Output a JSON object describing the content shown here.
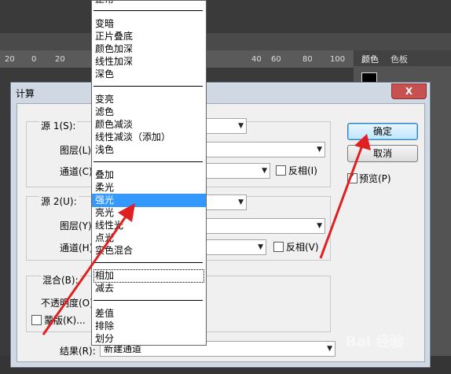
{
  "photoshop": {
    "ruler_ticks": [
      "20",
      "0",
      "20",
      "40",
      "60",
      "80",
      "100"
    ],
    "panel_tabs": [
      "颜色",
      "色板"
    ],
    "watermark": "Bai 经验"
  },
  "dialog": {
    "title": "计算",
    "close": "X",
    "source1": {
      "label": "源 1(S):",
      "layer_label": "图层(L)",
      "channel_label": "通道(C)",
      "invert_label": "反相(I)"
    },
    "source2": {
      "label": "源 2(U):",
      "layer_label": "图层(Y)",
      "channel_label": "通道(H)",
      "invert_label": "反相(V)"
    },
    "blending_label": "混合(B):",
    "blending_value": "相加",
    "opacity_label": "不透明度(O)",
    "mask_label": "蒙版(K)...",
    "result_label": "结果(R):",
    "result_value": "新建通道",
    "ok_label": "确定",
    "cancel_label": "取消",
    "preview_label": "预览(P)"
  },
  "blend_menu": {
    "items": [
      "正常",
      "变暗",
      "正片叠底",
      "颜色加深",
      "线性加深",
      "深色",
      "变亮",
      "滤色",
      "颜色减淡",
      "线性减淡（添加）",
      "浅色",
      "叠加",
      "柔光",
      "强光",
      "亮光",
      "线性光",
      "点光",
      "实色混合",
      "相加",
      "减去",
      "差值",
      "排除",
      "划分"
    ],
    "selected": "强光"
  }
}
